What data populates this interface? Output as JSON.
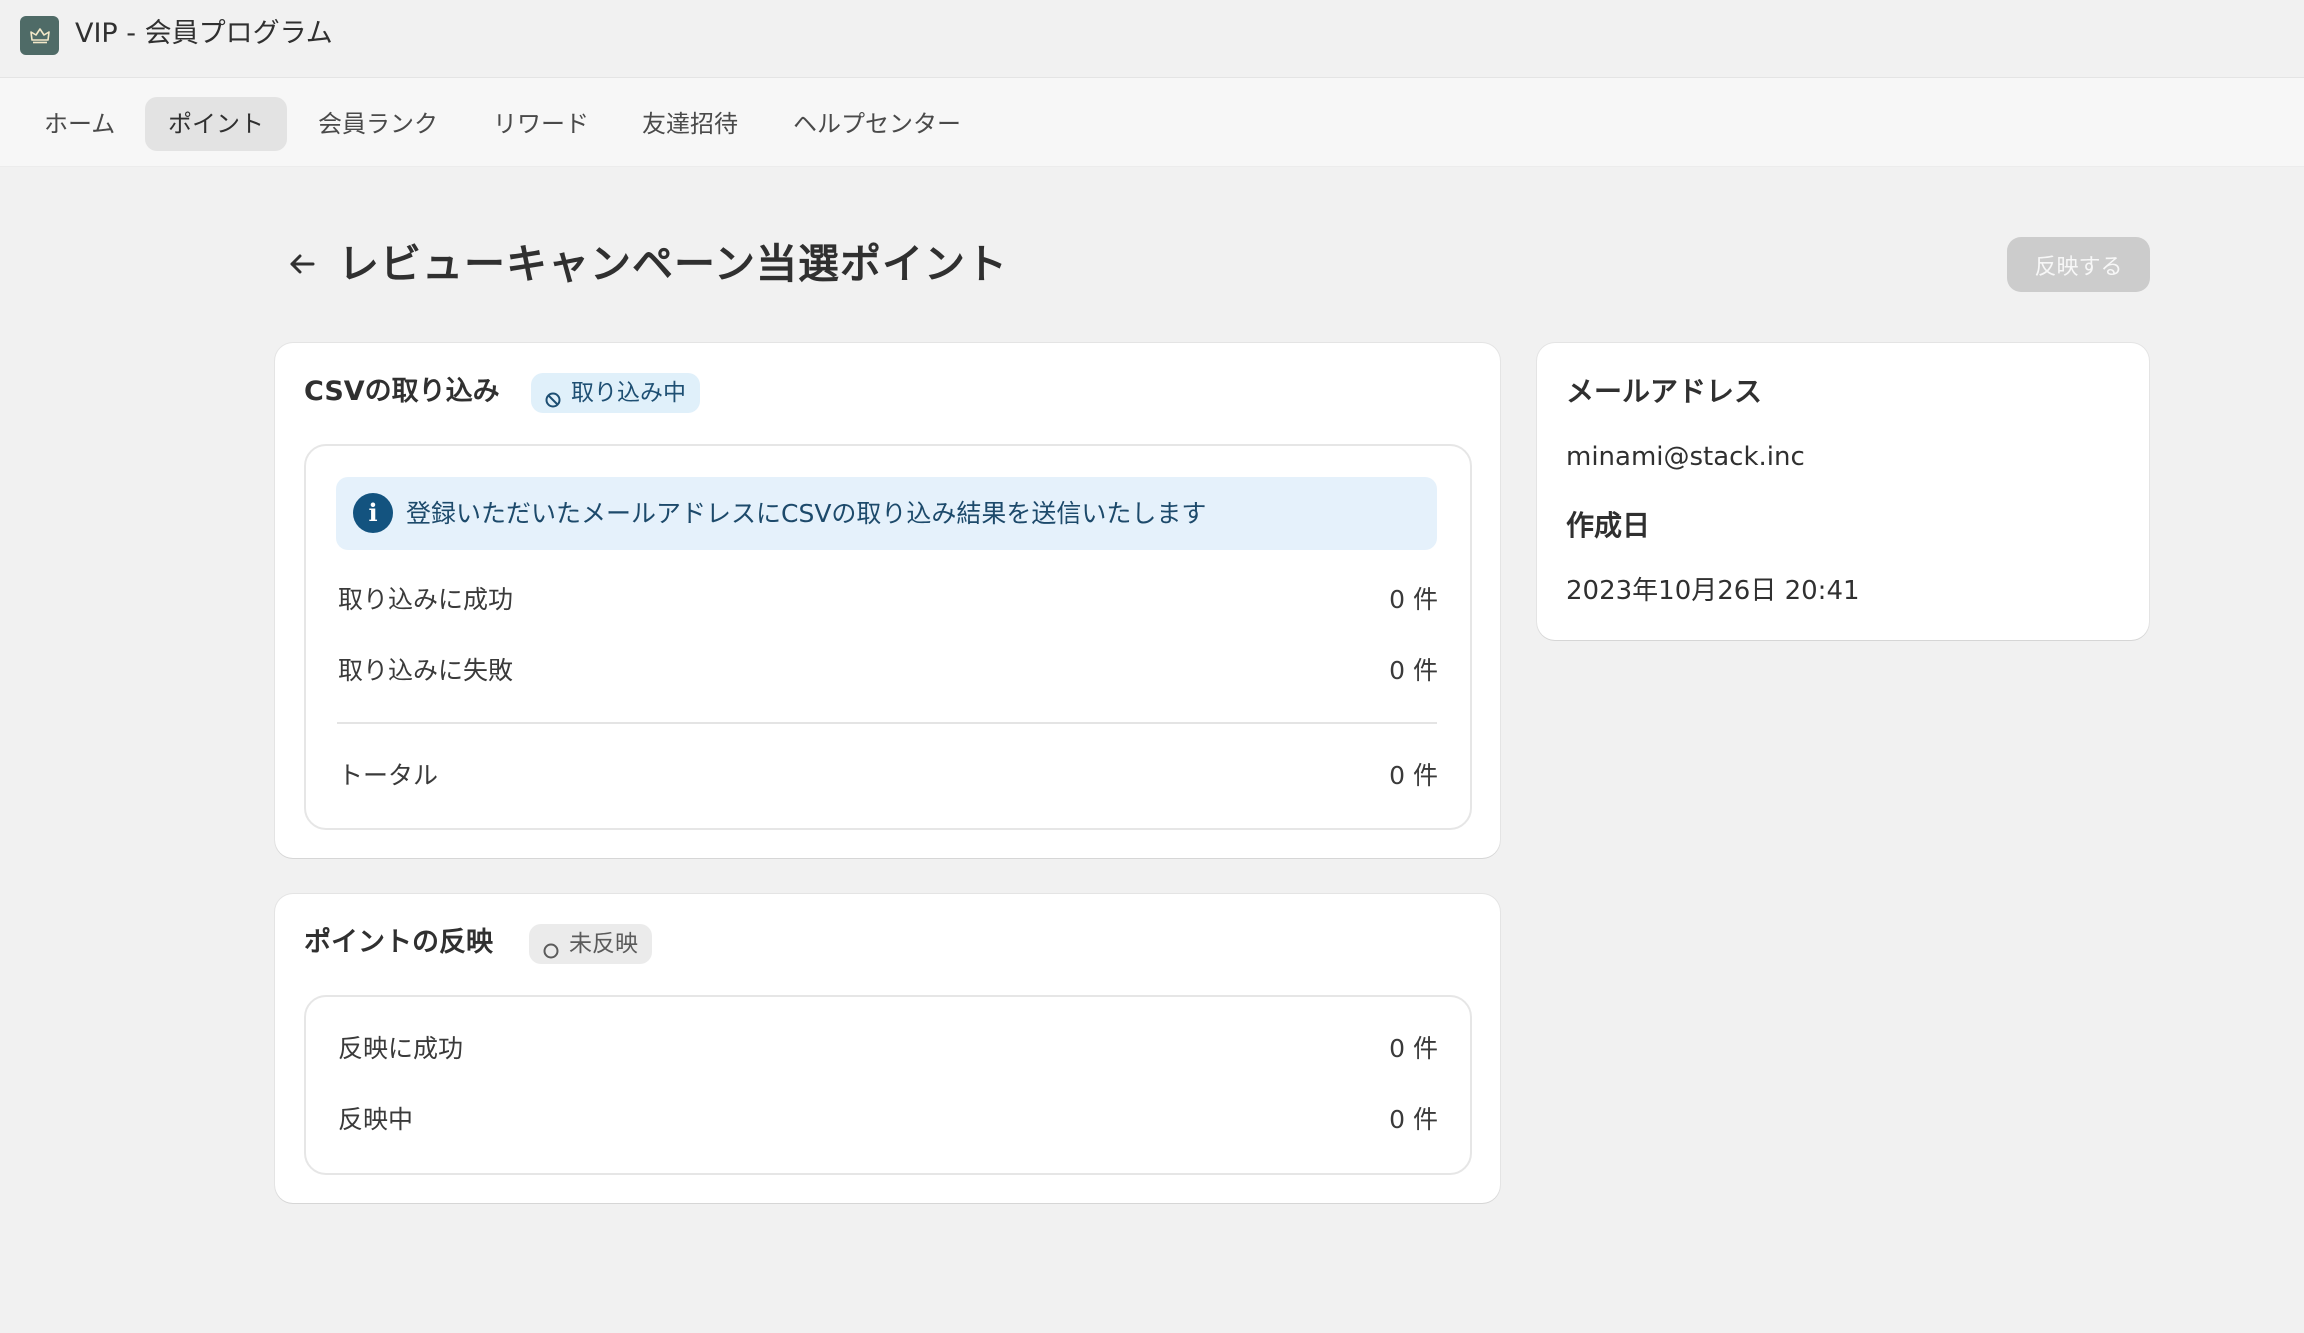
{
  "app": {
    "title": "VIP - 会員プログラム",
    "icon": "crown-icon"
  },
  "nav": {
    "items": [
      {
        "label": "ホーム",
        "active": false
      },
      {
        "label": "ポイント",
        "active": true
      },
      {
        "label": "会員ランク",
        "active": false
      },
      {
        "label": "リワード",
        "active": false
      },
      {
        "label": "友達招待",
        "active": false
      },
      {
        "label": "ヘルプセンター",
        "active": false
      }
    ]
  },
  "page": {
    "title": "レビューキャンペーン当選ポイント",
    "apply_button": "反映する"
  },
  "csv_card": {
    "title": "CSVの取り込み",
    "status_badge": "取り込み中",
    "banner": "登録いただいたメールアドレスにCSVの取り込み結果を送信いたします",
    "rows": [
      {
        "label": "取り込みに成功",
        "value": "0 件"
      },
      {
        "label": "取り込みに失敗",
        "value": "0 件"
      }
    ],
    "total": {
      "label": "トータル",
      "value": "0 件"
    }
  },
  "points_card": {
    "title": "ポイントの反映",
    "status_badge": "未反映",
    "rows": [
      {
        "label": "反映に成功",
        "value": "0 件"
      },
      {
        "label": "反映中",
        "value": "0 件"
      }
    ]
  },
  "side_card": {
    "email_heading": "メールアドレス",
    "email": "minami@stack.inc",
    "created_heading": "作成日",
    "created": "2023年10月26日 20:41"
  },
  "colors": {
    "background": "#f1f1f1",
    "info_badge_bg": "#e0f0fa",
    "info_badge_text": "#1e4f73",
    "banner_bg": "#e5f1fb",
    "banner_icon": "#13537f",
    "disabled_button": "#cccccc"
  }
}
